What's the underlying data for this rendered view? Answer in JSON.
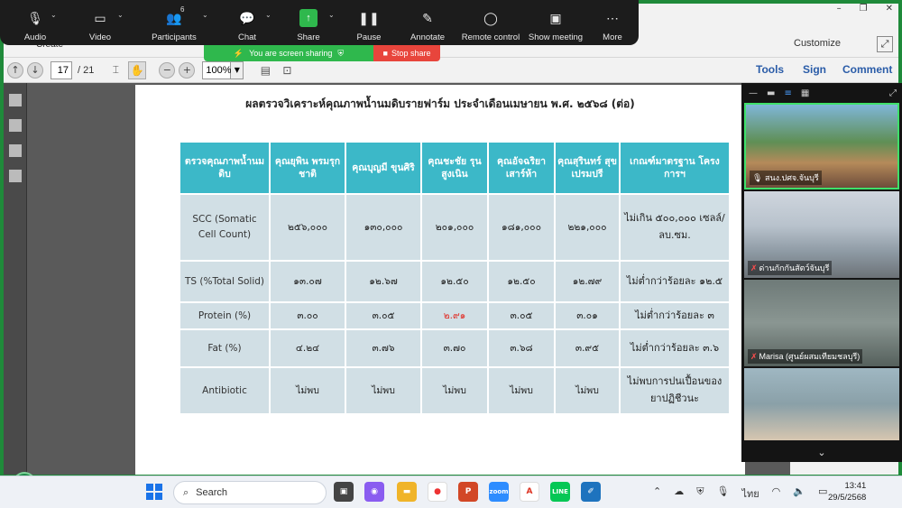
{
  "zoom_toolbar": {
    "audio": "Audio",
    "video": "Video",
    "participants": "Participants",
    "participants_count": "6",
    "chat": "Chat",
    "share": "Share",
    "pause": "Pause",
    "annotate": "Annotate",
    "remote_control": "Remote control",
    "show_meeting": "Show meeting",
    "more": "More"
  },
  "share_banner": {
    "status": "You are screen sharing",
    "stop": "Stop share"
  },
  "acrobat": {
    "create": "Create",
    "customize": "Customize",
    "page_current": "17",
    "page_total": "/ 21",
    "zoom": "100%",
    "tools": "Tools",
    "sign": "Sign",
    "comment": "Comment"
  },
  "document": {
    "title": "ผลตรวจวิเคราะห์คุณภาพน้ำนมดิบรายฟาร์ม ประจำเดือนเมษายน พ.ศ. ๒๕๖๘ (ต่อ)",
    "headers": [
      "ตรวจคุณภาพน้ำนมดิบ",
      "คุณยุพิน พรมรุกชาติ",
      "คุณบุญมี ขุนศิริ",
      "คุณชะชัย รุนสูงเนิน",
      "คุณอัจฉริยา เสาร์ห้า",
      "คุณสุรินทร์ สุขเปรมปรี",
      "เกณฑ์มาตรฐาน โครงการฯ"
    ],
    "rows": [
      {
        "label": "SCC (Somatic Cell Count)",
        "values": [
          "๒๕๖,๐๐๐",
          "๑๓๐,๐๐๐",
          "๒๐๑,๐๐๐",
          "๑๘๑,๐๐๐",
          "๒๒๑,๐๐๐"
        ],
        "criteria": "ไม่เกิน ๕๐๐,๐๐๐ เซลล์/ลบ.ซม."
      },
      {
        "label": "TS (%Total Solid)",
        "values": [
          "๑๓.๐๗",
          "๑๒.๖๗",
          "๑๒.๕๐",
          "๑๒.๕๐",
          "๑๒.๗๙"
        ],
        "criteria": "ไม่ต่ำกว่าร้อยละ ๑๒.๕"
      },
      {
        "label": "Protein (%)",
        "values": [
          "๓.๐๐",
          "๓.๐๕",
          "๒.๙๑",
          "๓.๐๕",
          "๓.๐๑"
        ],
        "criteria": "ไม่ต่ำกว่าร้อยละ ๓"
      },
      {
        "label": "Fat (%)",
        "values": [
          "๔.๒๔",
          "๓.๗๖",
          "๓.๗๐",
          "๓.๖๘",
          "๓.๙๕"
        ],
        "criteria": "ไม่ต่ำกว่าร้อยละ ๓.๖"
      },
      {
        "label": "Antibiotic",
        "values": [
          "ไม่พบ",
          "ไม่พบ",
          "ไม่พบ",
          "ไม่พบ",
          "ไม่พบ"
        ],
        "criteria": "ไม่พบการปนเปื้อนของยาปฏิชีวนะ"
      }
    ],
    "highlight_color": "#e0332c",
    "header_color": "#3cb8c8"
  },
  "video_panel": {
    "participants": [
      {
        "name": "สนง.ปศจ.จันบุรี"
      },
      {
        "name": "ด่านกักกันสัตว์จันบุรี"
      },
      {
        "name": "Marisa (ศูนย์ผสมเทียมชลบุรี)"
      }
    ]
  },
  "taskbar": {
    "search": "Search",
    "lang": "ไทย",
    "time": "13:41",
    "date": "29/5/2568"
  }
}
